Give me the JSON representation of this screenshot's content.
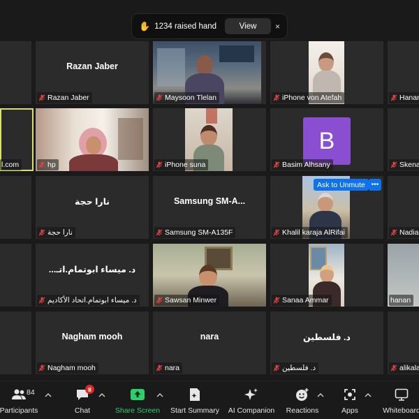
{
  "notification": {
    "text": "1234 raised hand",
    "view_label": "View",
    "close_label": "×"
  },
  "tiles": {
    "r1c1": {
      "label": ""
    },
    "r1c2": {
      "center": "Razan Jaber",
      "label": "Razan Jaber"
    },
    "r1c3": {
      "label": "Maysoon Tlelan"
    },
    "r1c4": {
      "label": "iPhone von Atefah"
    },
    "r1c5": {
      "label": "Hanan"
    },
    "r2c1": {
      "label": "l.com"
    },
    "r2c2": {
      "label": "hp"
    },
    "r2c3": {
      "label": "iPhone suna"
    },
    "r2c4": {
      "avatar": "B",
      "label": "Basim Alhsany"
    },
    "r2c5": {
      "label": "Skena"
    },
    "r3c2": {
      "center": "نارا حجة",
      "label": "نارا حجة"
    },
    "r3c3": {
      "center": "Samsung  SM-A...",
      "label": "Samsung SM-A135F"
    },
    "r3c4": {
      "label": "Khalil karaja AlRifai",
      "unmute": "Ask to Unmute",
      "more": "•••"
    },
    "r3c5": {
      "label": "Nadia"
    },
    "r4c2": {
      "center": "د. ميساء ابوتمام.اتـ...",
      "label": "د. ميساء ابوتمام.اتحاد الأكاديم"
    },
    "r4c3": {
      "label": "Sawsan Minwer"
    },
    "r4c4": {
      "label": "Sanaa Ammar"
    },
    "r4c5": {
      "label": "hanan"
    },
    "r5c2": {
      "center": "Nagham mooh",
      "label": "Nagham mooh"
    },
    "r5c3": {
      "center": "nara",
      "label": "nara"
    },
    "r5c4": {
      "center": "د. فلسطين",
      "label": "د. فلسطين"
    },
    "r5c5": {
      "label": "alikala"
    }
  },
  "toolbar": {
    "participants": {
      "label": "Participants",
      "count": "84",
      "icon": "participants-icon"
    },
    "chat": {
      "label": "Chat",
      "badge": "8",
      "icon": "chat-icon"
    },
    "share": {
      "label": "Share Screen",
      "icon": "share-screen-icon",
      "color": "#2ad16a"
    },
    "summary": {
      "label": "Start Summary",
      "icon": "summary-icon"
    },
    "companion": {
      "label": "AI Companion",
      "icon": "ai-companion-icon"
    },
    "reactions": {
      "label": "Reactions",
      "icon": "reactions-icon"
    },
    "apps": {
      "label": "Apps",
      "icon": "apps-icon"
    },
    "whiteboards": {
      "label": "Whiteboard",
      "icon": "whiteboard-icon"
    }
  },
  "colors": {
    "background": "#1a1a1a",
    "tile": "#2b2b2b",
    "active_speaker_border": "#d8e070",
    "muted_mic": "#e04040",
    "unmute_button": "#0e72ed",
    "avatar": "#8a4fd1"
  }
}
